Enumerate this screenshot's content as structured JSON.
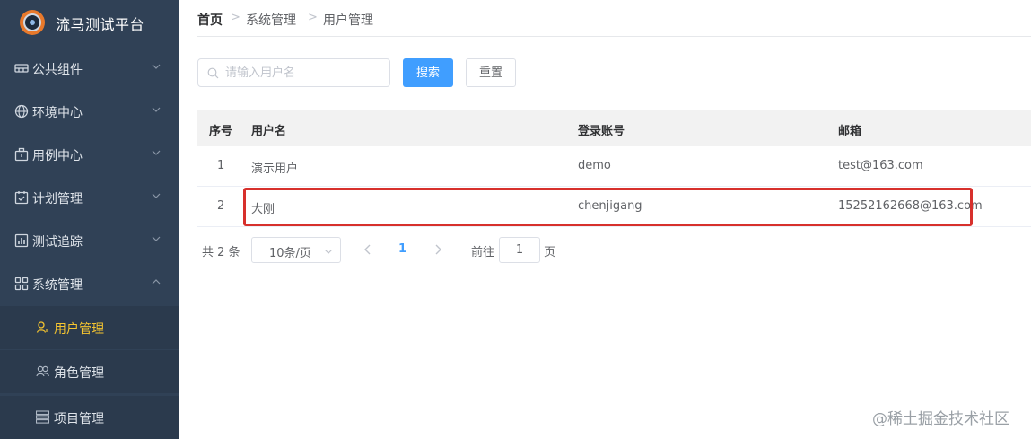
{
  "app": {
    "title": "流马测试平台"
  },
  "sidebar": {
    "items": [
      {
        "label": "公共组件",
        "icon": "component-icon"
      },
      {
        "label": "环境中心",
        "icon": "globe-icon"
      },
      {
        "label": "用例中心",
        "icon": "briefcase-icon"
      },
      {
        "label": "计划管理",
        "icon": "calendar-check-icon"
      },
      {
        "label": "测试追踪",
        "icon": "bar-chart-icon"
      },
      {
        "label": "系统管理",
        "icon": "grid-icon"
      }
    ],
    "subitems": [
      {
        "label": "用户管理",
        "icon": "user-icon",
        "active": true
      },
      {
        "label": "角色管理",
        "icon": "users-icon",
        "active": false
      },
      {
        "label": "项目管理",
        "icon": "list-icon",
        "active": false
      }
    ]
  },
  "breadcrumb": {
    "home": "首页",
    "level1": "系统管理",
    "level2": "用户管理"
  },
  "search": {
    "placeholder": "请输入用户名",
    "value": "",
    "search_label": "搜索",
    "reset_label": "重置"
  },
  "table": {
    "columns": [
      "序号",
      "用户名",
      "登录账号",
      "邮箱"
    ],
    "rows": [
      {
        "index": "1",
        "username": "演示用户",
        "account": "demo",
        "email": "test@163.com"
      },
      {
        "index": "2",
        "username": "大刚",
        "account": "chenjigang",
        "email": "15252162668@163.com"
      }
    ]
  },
  "pagination": {
    "total_label": "共 2 条",
    "page_size": "10条/页",
    "current_page": "1",
    "goto_label": "前往",
    "goto_value": "1",
    "page_suffix": "页"
  },
  "watermark": "@稀土掘金技术社区",
  "colors": {
    "sidebar_bg": "#304156",
    "primary": "#409eff",
    "active_menu": "#f4c430",
    "highlight": "#d7302c"
  }
}
